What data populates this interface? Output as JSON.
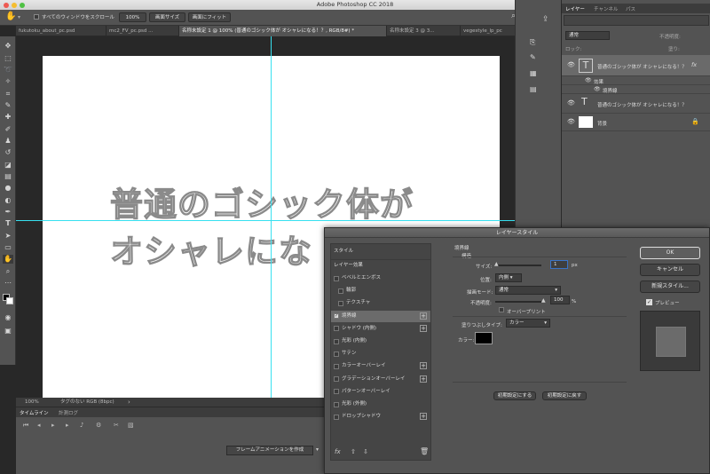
{
  "window": {
    "title": "Adobe Photoshop CC 2018"
  },
  "options_bar": {
    "scroll_all_label": "すべてのウィンドウをスクロール",
    "zoom_value": "100%",
    "fit_screen_label": "画面サイズ",
    "fill_screen_label": "画面にフィット"
  },
  "tabs": [
    {
      "label": "fukutoku_about_pc.psd"
    },
    {
      "label": "mc2_FV_pc.psd ..."
    },
    {
      "label": "名称未設定 1 @ 100% (普通のゴシック体が オシャレになる！？, RGB/8#) *"
    },
    {
      "label": "名称未設定 3 @ 3..."
    },
    {
      "label": "vegestyle_lp_pc"
    }
  ],
  "canvas": {
    "line1": "普通のゴシック体が",
    "line2": "オシャレにな"
  },
  "status_bar": {
    "zoom": "100%",
    "profile": "タグのない RGB (8bpc)"
  },
  "timeline": {
    "tab_timeline": "タイムライン",
    "tab_measure": "計測ログ",
    "create_button": "フレームアニメーションを作成"
  },
  "layers_panel": {
    "tabs": [
      "レイヤー",
      "チャンネル",
      "パス"
    ],
    "blend_mode": "通常",
    "opacity_label": "不透明度:",
    "lock_label": "ロック:",
    "fill_label": "塗り:",
    "layers": [
      {
        "name": "普通のゴシック体が オシャレになる！？",
        "type": "text",
        "fx": "fx"
      },
      {
        "name": "効果",
        "type": "effects"
      },
      {
        "name": "境界線",
        "type": "effect"
      },
      {
        "name": "普通のゴシック体が オシャレになる！？",
        "type": "text"
      },
      {
        "name": "背景",
        "type": "background"
      }
    ]
  },
  "dialog": {
    "title": "レイヤースタイル",
    "style_header": "スタイル",
    "effects_header": "レイヤー効果",
    "styles": [
      {
        "label": "ベベルとエンボス",
        "checked": false,
        "plus": false
      },
      {
        "label": "輪郭",
        "checked": false,
        "plus": false,
        "indent": true
      },
      {
        "label": "テクスチャ",
        "checked": false,
        "plus": false,
        "indent": true
      },
      {
        "label": "境界線",
        "checked": true,
        "plus": true,
        "selected": true
      },
      {
        "label": "シャドウ (内側)",
        "checked": false,
        "plus": true
      },
      {
        "label": "光彩 (内側)",
        "checked": false,
        "plus": false
      },
      {
        "label": "サテン",
        "checked": false,
        "plus": false
      },
      {
        "label": "カラーオーバーレイ",
        "checked": false,
        "plus": true
      },
      {
        "label": "グラデーションオーバーレイ",
        "checked": false,
        "plus": true
      },
      {
        "label": "パターンオーバーレイ",
        "checked": false,
        "plus": false
      },
      {
        "label": "光彩 (外側)",
        "checked": false,
        "plus": false
      },
      {
        "label": "ドロップシャドウ",
        "checked": false,
        "plus": true
      }
    ],
    "section_title": "境界線",
    "structure_label": "構造",
    "size_label": "サイズ:",
    "size_value": "1",
    "size_unit": "px",
    "position_label": "位置:",
    "position_value": "内側",
    "blend_label": "描画モード:",
    "blend_value": "通常",
    "opacity_label": "不透明度:",
    "opacity_value": "100",
    "opacity_unit": "%",
    "overprint_label": "オーバープリント",
    "fill_type_label": "塗りつぶしタイプ:",
    "fill_type_value": "カラー",
    "color_label": "カラー:",
    "color_value": "#000000",
    "make_default": "初期設定にする",
    "reset_default": "初期設定に戻す",
    "ok": "OK",
    "cancel": "キャンセル",
    "new_style": "新規スタイル...",
    "preview": "プレビュー"
  },
  "colors": {
    "guide": "#37e0f0",
    "panel": "#535353",
    "stroke": "#8a8a8a"
  }
}
